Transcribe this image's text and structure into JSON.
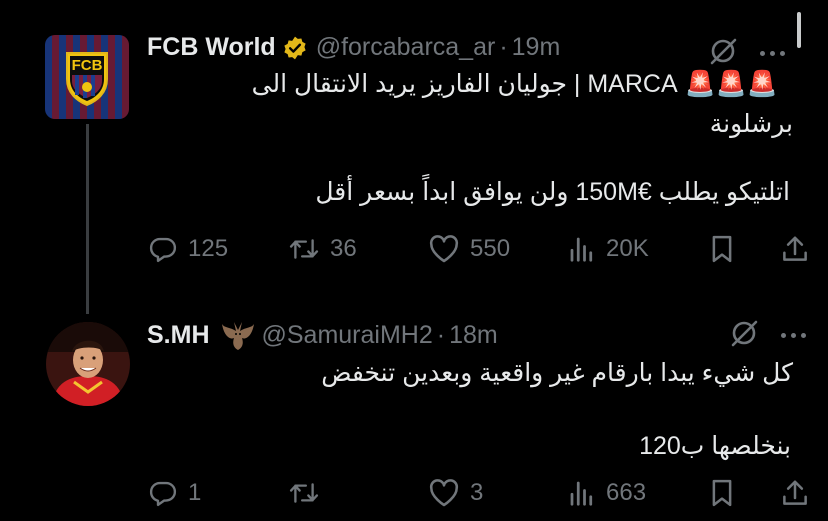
{
  "tweets": [
    {
      "name": "FCB World",
      "handle": "@forcabarca_ar",
      "time": "19m",
      "avatar_text": "FCB",
      "line1": "🚨🚨🚨 MARCA | جوليان الفاريز يريد الانتقال الى",
      "line2": "برشلونة",
      "line3": "اتلتيكو يطلب €150M ولن يوافق ابداً بسعر أقل",
      "replies": "125",
      "retweets": "36",
      "likes": "550",
      "views": "20K"
    },
    {
      "name": "S.MH",
      "handle": "@SamuraiMH2",
      "time": "18m",
      "line1": "كل شيء يبدا بارقام غير واقعية وبعدين تنخفض",
      "line2": "بنخلصها ب120",
      "replies": "1",
      "likes": "3",
      "views": "663"
    }
  ],
  "colors": {
    "background": "#000000",
    "text": "#e7e9ea",
    "muted": "#71767b",
    "verified_gold": "#e2b719"
  },
  "icons": [
    "grok-icon",
    "more-icon",
    "verified-badge-icon",
    "bat-emoji",
    "reply-icon",
    "retweet-icon",
    "like-icon",
    "views-icon",
    "bookmark-icon",
    "share-icon"
  ]
}
